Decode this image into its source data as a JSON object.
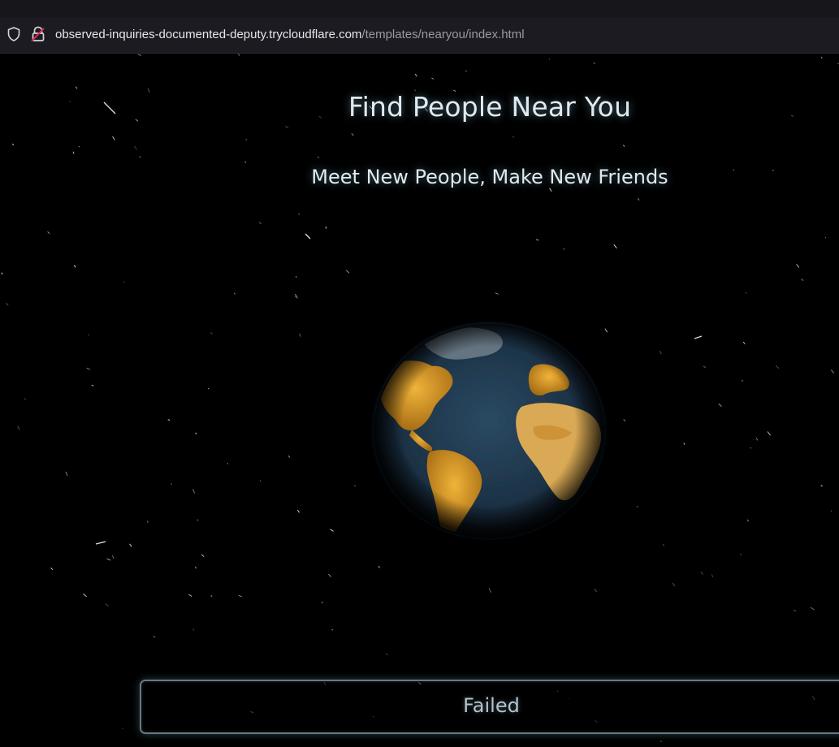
{
  "browser": {
    "url_host": "observed-inquiries-documented-deputy.trycloudflare.com",
    "url_path": "/templates/nearyou/index.html",
    "shield_icon": "tracking-protection-shield-icon",
    "lock_icon": "insecure-lock-icon"
  },
  "page": {
    "title": "Find People Near You",
    "subtitle": "Meet New People, Make New Friends",
    "status": "Failed",
    "globe_icon": "earth-globe-icon"
  },
  "colors": {
    "background": "#000000",
    "heading": "#dfe9ee",
    "glow": "#8cc8e6",
    "land": "#d99a25",
    "ocean": "#1c3246"
  }
}
